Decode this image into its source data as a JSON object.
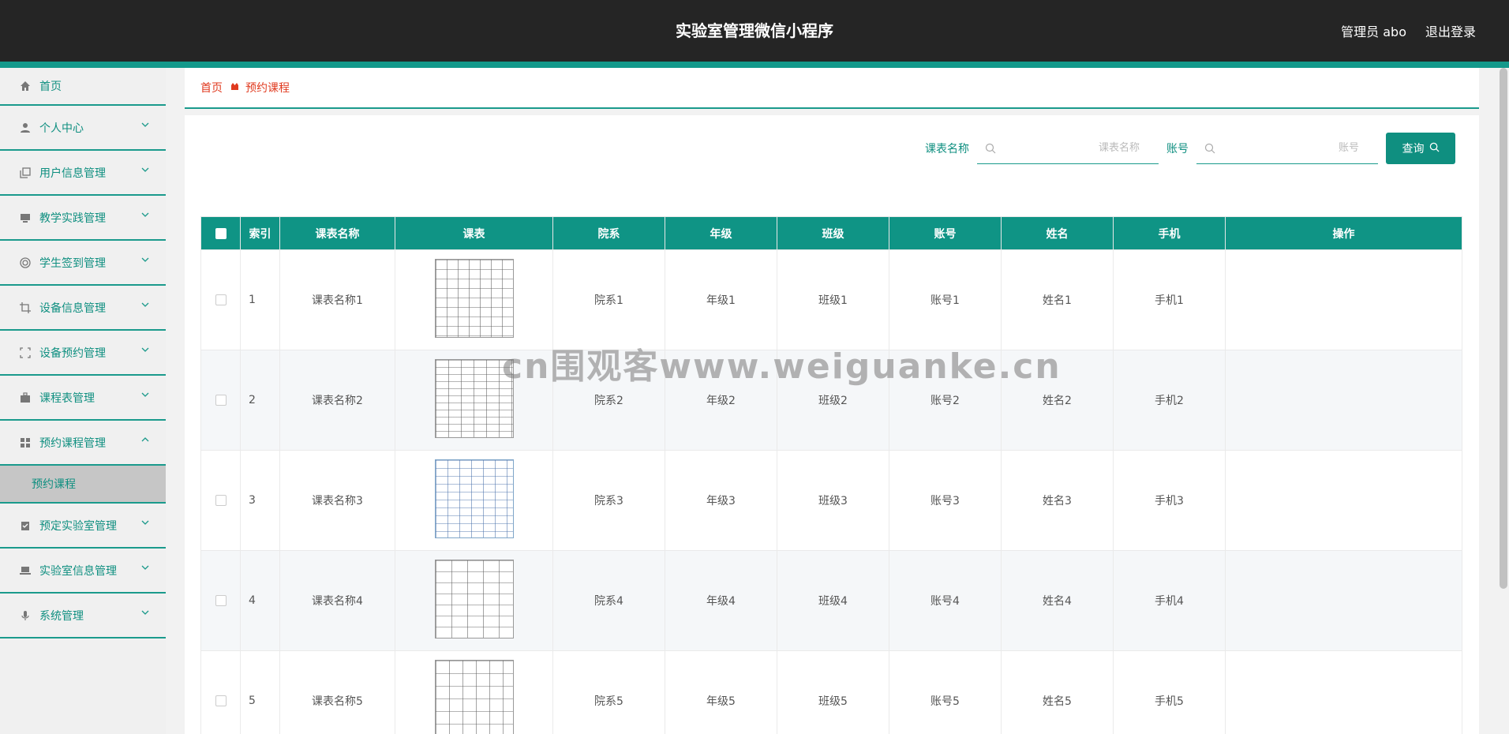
{
  "header": {
    "title": "实验室管理微信小程序",
    "admin_label": "管理员 abo",
    "logout_label": "退出登录"
  },
  "sidebar": {
    "items": [
      {
        "label": "首页",
        "icon": "home-icon"
      },
      {
        "label": "个人中心",
        "icon": "user-icon"
      },
      {
        "label": "用户信息管理",
        "icon": "copy-icon"
      },
      {
        "label": "教学实践管理",
        "icon": "monitor-icon"
      },
      {
        "label": "学生签到管理",
        "icon": "target-icon"
      },
      {
        "label": "设备信息管理",
        "icon": "crop-icon"
      },
      {
        "label": "设备预约管理",
        "icon": "scan-icon"
      },
      {
        "label": "课程表管理",
        "icon": "briefcase-icon"
      },
      {
        "label": "预约课程管理",
        "icon": "grid-icon"
      },
      {
        "label": "预定实验室管理",
        "icon": "clipboard-icon"
      },
      {
        "label": "实验室信息管理",
        "icon": "laptop-icon"
      },
      {
        "label": "系统管理",
        "icon": "mic-icon"
      }
    ],
    "active_sub": "预约课程"
  },
  "breadcrumb": {
    "home": "首页",
    "current": "预约课程"
  },
  "search": {
    "label1": "课表名称",
    "placeholder1": "课表名称",
    "label2": "账号",
    "placeholder2": "账号",
    "button": "查询"
  },
  "table": {
    "headers": [
      "索引",
      "课表名称",
      "课表",
      "院系",
      "年级",
      "班级",
      "账号",
      "姓名",
      "手机",
      "操作"
    ],
    "rows": [
      {
        "idx": "1",
        "name": "课表名称1",
        "dept": "院系1",
        "grade": "年级1",
        "cls": "班级1",
        "acct": "账号1",
        "person": "姓名1",
        "phone": "手机1"
      },
      {
        "idx": "2",
        "name": "课表名称2",
        "dept": "院系2",
        "grade": "年级2",
        "cls": "班级2",
        "acct": "账号2",
        "person": "姓名2",
        "phone": "手机2"
      },
      {
        "idx": "3",
        "name": "课表名称3",
        "dept": "院系3",
        "grade": "年级3",
        "cls": "班级3",
        "acct": "账号3",
        "person": "姓名3",
        "phone": "手机3"
      },
      {
        "idx": "4",
        "name": "课表名称4",
        "dept": "院系4",
        "grade": "年级4",
        "cls": "班级4",
        "acct": "账号4",
        "person": "姓名4",
        "phone": "手机4"
      },
      {
        "idx": "5",
        "name": "课表名称5",
        "dept": "院系5",
        "grade": "年级5",
        "cls": "班级5",
        "acct": "账号5",
        "person": "姓名5",
        "phone": "手机5"
      }
    ]
  },
  "watermark": "cn围观客www.weiguanke.cn",
  "colors": {
    "accent": "#0f9485",
    "topbar": "#252525",
    "breadcrumb": "#e03a1f"
  }
}
